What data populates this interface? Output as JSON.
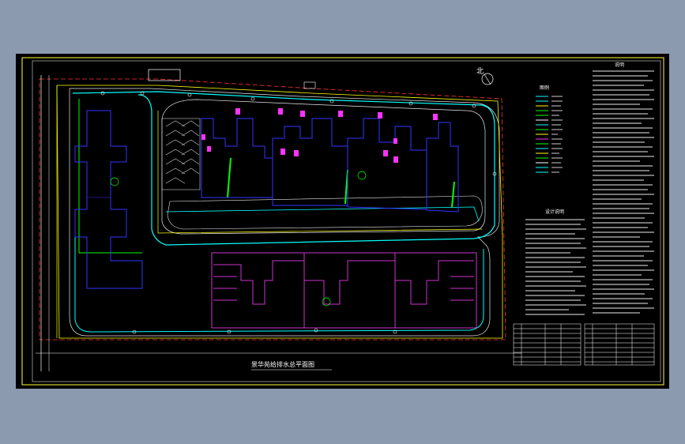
{
  "viewport": {
    "background": "#8c9ab0",
    "sheet_background": "#000000",
    "frame_color": "#ffff33"
  },
  "drawing": {
    "title": "景华苑给排水总平面图",
    "north_label": "北",
    "legend_title": "图例",
    "notes_title_1": "说明",
    "notes_title_2": "设计说明"
  },
  "colors": {
    "building": "#3333ff",
    "building_south": "#cc33cc",
    "water_pipe": "#00ffff",
    "drain_pipe": "#ffff00",
    "fire_pipe": "#00ff00",
    "node": "#ff33ff",
    "road": "#ffffff",
    "red_line": "#ff3333"
  }
}
